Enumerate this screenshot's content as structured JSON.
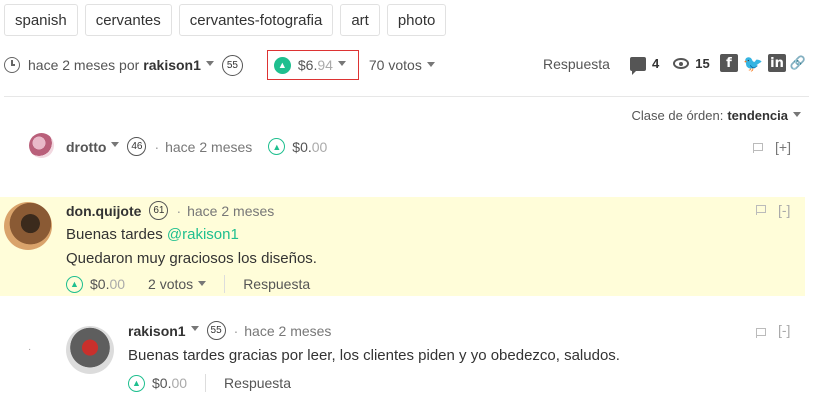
{
  "tags": [
    "spanish",
    "cervantes",
    "cervantes-fotografia",
    "art",
    "photo"
  ],
  "post": {
    "time": "hace 2 meses por",
    "author": "rakison1",
    "reputation": "55",
    "payout_main": "$6.",
    "payout_cents": "94",
    "votes": "70 votos",
    "reply": "Respuesta",
    "comments_count": "4",
    "views_count": "15"
  },
  "sort": {
    "label": "Clase de órden:",
    "value": "tendencia"
  },
  "comments": [
    {
      "author": "drotto",
      "reputation": "46",
      "time": "hace 2 meses",
      "payout_main": "$0.",
      "payout_cents": "00",
      "toggle": "[+]"
    },
    {
      "author": "don.quijote",
      "reputation": "61",
      "time": "hace 2 meses",
      "body_line1_prefix": "Buenas tardes ",
      "mention": "@rakison1",
      "body_line2": "Quedaron muy graciosos los diseños.",
      "payout_main": "$0.",
      "payout_cents": "00",
      "votes": "2 votos",
      "reply": "Respuesta",
      "toggle": "[-]",
      "highlight_color": "#fffdd9"
    },
    {
      "author": "rakison1",
      "reputation": "55",
      "time": "hace 2 meses",
      "body": "Buenas tardes gracias por leer, los clientes piden y yo obedezco, saludos.",
      "payout_main": "$0.",
      "payout_cents": "00",
      "reply": "Respuesta",
      "toggle": "[-]"
    }
  ],
  "colors": {
    "accent": "#1fbf8f",
    "highlight_border": "#dd3333"
  },
  "icons": [
    "clock-icon",
    "upvote-icon",
    "comments-icon",
    "eye-icon",
    "facebook-icon",
    "twitter-icon",
    "linkedin-icon",
    "link-icon",
    "flag-icon"
  ]
}
